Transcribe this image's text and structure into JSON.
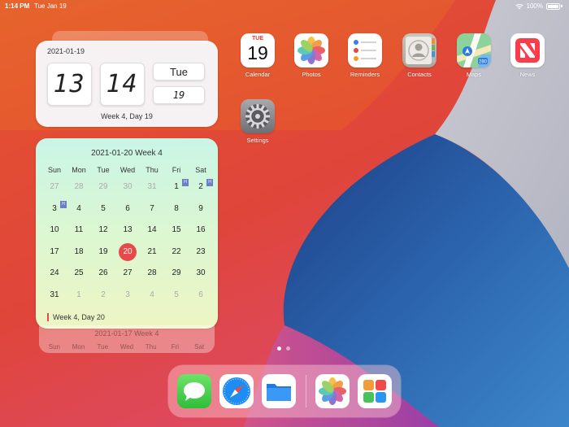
{
  "status": {
    "time": "1:14 PM",
    "date": "Tue Jan 19",
    "battery": "100%"
  },
  "clock_widget": {
    "date": "2021-01-19",
    "hour": "13",
    "minute": "14",
    "weekday": "Tue",
    "day": "19",
    "footer": "Week 4, Day 19"
  },
  "calendar_widget": {
    "title": "2021-01-20 Week 4",
    "headers": [
      "Sun",
      "Mon",
      "Tue",
      "Wed",
      "Thu",
      "Fri",
      "Sat"
    ],
    "holiday_marker": "H",
    "cells": [
      {
        "d": "27",
        "dim": true
      },
      {
        "d": "28",
        "dim": true
      },
      {
        "d": "29",
        "dim": true
      },
      {
        "d": "30",
        "dim": true
      },
      {
        "d": "31",
        "dim": true
      },
      {
        "d": "1",
        "holiday": true
      },
      {
        "d": "2",
        "holiday": true
      },
      {
        "d": "3",
        "holiday": true
      },
      {
        "d": "4"
      },
      {
        "d": "5"
      },
      {
        "d": "6"
      },
      {
        "d": "7"
      },
      {
        "d": "8"
      },
      {
        "d": "9"
      },
      {
        "d": "10"
      },
      {
        "d": "11"
      },
      {
        "d": "12"
      },
      {
        "d": "13"
      },
      {
        "d": "14"
      },
      {
        "d": "15"
      },
      {
        "d": "16"
      },
      {
        "d": "17"
      },
      {
        "d": "18"
      },
      {
        "d": "19"
      },
      {
        "d": "20",
        "today": true
      },
      {
        "d": "21"
      },
      {
        "d": "22"
      },
      {
        "d": "23"
      },
      {
        "d": "24"
      },
      {
        "d": "25"
      },
      {
        "d": "26"
      },
      {
        "d": "27"
      },
      {
        "d": "28"
      },
      {
        "d": "29"
      },
      {
        "d": "30"
      },
      {
        "d": "31"
      },
      {
        "d": "1",
        "dim": true
      },
      {
        "d": "2",
        "dim": true
      },
      {
        "d": "3",
        "dim": true
      },
      {
        "d": "4",
        "dim": true
      },
      {
        "d": "5",
        "dim": true
      },
      {
        "d": "6",
        "dim": true
      }
    ],
    "footer": "Week 4, Day 20"
  },
  "stacked_widget": {
    "title": "2021-01-17 Week 4",
    "headers": [
      "Sun",
      "Mon",
      "Tue",
      "Wed",
      "Thu",
      "Fri",
      "Sat"
    ]
  },
  "apps": {
    "calendar": {
      "label": "Calendar",
      "icon_dow": "TUE",
      "icon_day": "19"
    },
    "photos": {
      "label": "Photos"
    },
    "reminders": {
      "label": "Reminders"
    },
    "contacts": {
      "label": "Contacts"
    },
    "maps": {
      "label": "Maps",
      "icon_shield": "280"
    },
    "news": {
      "label": "News"
    },
    "settings": {
      "label": "Settings"
    }
  },
  "dock": {
    "items": [
      "messages-icon",
      "safari-icon",
      "files-icon",
      "photos-icon",
      "app-library-icon"
    ]
  },
  "colors": {
    "accent_red": "#e64a4a",
    "holiday_badge": "#6a7fc4"
  }
}
